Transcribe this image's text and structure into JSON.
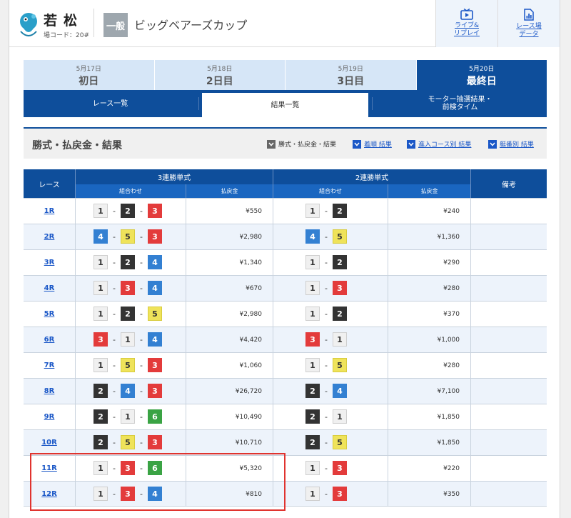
{
  "header": {
    "stadium_name": "若松",
    "stadium_code": "場コード：20#",
    "grade": "一般",
    "race_title": "ビッグベアーズカップ",
    "live_label_1": "ライブ&",
    "live_label_2": "リプレイ",
    "data_label_1": "レース場",
    "data_label_2": "データ"
  },
  "days": [
    {
      "date": "5月17日",
      "name": "初日"
    },
    {
      "date": "5月18日",
      "name": "2日目"
    },
    {
      "date": "5月19日",
      "name": "3日目"
    },
    {
      "date": "5月20日",
      "name": "最終日"
    }
  ],
  "subtabs": {
    "race_list": "レース一覧",
    "results": "結果一覧",
    "motor_1": "モーター抽選結果・",
    "motor_2": "前検タイム"
  },
  "section": {
    "title": "勝式・払戻金・結果",
    "filter_1": "勝式・払戻金・結果",
    "filter_2": "着順 結果",
    "filter_3": "進入コース別 結果",
    "filter_4": "艇番別 結果"
  },
  "table": {
    "col_race": "レース",
    "col_trifecta": "3連勝単式",
    "col_exacta": "2連勝単式",
    "col_note": "備考",
    "col_combo": "組合わせ",
    "col_payout": "払戻金",
    "rows": [
      {
        "race": "1R",
        "tri": [
          1,
          2,
          3
        ],
        "tri_pay": "¥550",
        "ex": [
          1,
          2
        ],
        "ex_pay": "¥240"
      },
      {
        "race": "2R",
        "tri": [
          4,
          5,
          3
        ],
        "tri_pay": "¥2,980",
        "ex": [
          4,
          5
        ],
        "ex_pay": "¥1,360"
      },
      {
        "race": "3R",
        "tri": [
          1,
          2,
          4
        ],
        "tri_pay": "¥1,340",
        "ex": [
          1,
          2
        ],
        "ex_pay": "¥290"
      },
      {
        "race": "4R",
        "tri": [
          1,
          3,
          4
        ],
        "tri_pay": "¥670",
        "ex": [
          1,
          3
        ],
        "ex_pay": "¥280"
      },
      {
        "race": "5R",
        "tri": [
          1,
          2,
          5
        ],
        "tri_pay": "¥2,980",
        "ex": [
          1,
          2
        ],
        "ex_pay": "¥370"
      },
      {
        "race": "6R",
        "tri": [
          3,
          1,
          4
        ],
        "tri_pay": "¥4,420",
        "ex": [
          3,
          1
        ],
        "ex_pay": "¥1,000"
      },
      {
        "race": "7R",
        "tri": [
          1,
          5,
          3
        ],
        "tri_pay": "¥1,060",
        "ex": [
          1,
          5
        ],
        "ex_pay": "¥280"
      },
      {
        "race": "8R",
        "tri": [
          2,
          4,
          3
        ],
        "tri_pay": "¥26,720",
        "ex": [
          2,
          4
        ],
        "ex_pay": "¥7,100"
      },
      {
        "race": "9R",
        "tri": [
          2,
          1,
          6
        ],
        "tri_pay": "¥10,490",
        "ex": [
          2,
          1
        ],
        "ex_pay": "¥1,850"
      },
      {
        "race": "10R",
        "tri": [
          2,
          5,
          3
        ],
        "tri_pay": "¥10,710",
        "ex": [
          2,
          5
        ],
        "ex_pay": "¥1,850"
      },
      {
        "race": "11R",
        "tri": [
          1,
          3,
          6
        ],
        "tri_pay": "¥5,320",
        "ex": [
          1,
          3
        ],
        "ex_pay": "¥220"
      },
      {
        "race": "12R",
        "tri": [
          1,
          3,
          4
        ],
        "tri_pay": "¥810",
        "ex": [
          1,
          3
        ],
        "ex_pay": "¥350"
      }
    ]
  },
  "colors": {
    "primary": "#0e4e9b",
    "link": "#1a57c7",
    "highlight": "#e0332e",
    "boat_1": "#f0f0f0",
    "boat_2": "#333333",
    "boat_3": "#e33b3b",
    "boat_4": "#3380d2",
    "boat_5": "#efe35a",
    "boat_6": "#3aa344"
  },
  "icons": {
    "logo": "mascot-logo",
    "live": "tv-play-icon",
    "data": "chart-doc-icon",
    "checkbox": "check-icon"
  }
}
